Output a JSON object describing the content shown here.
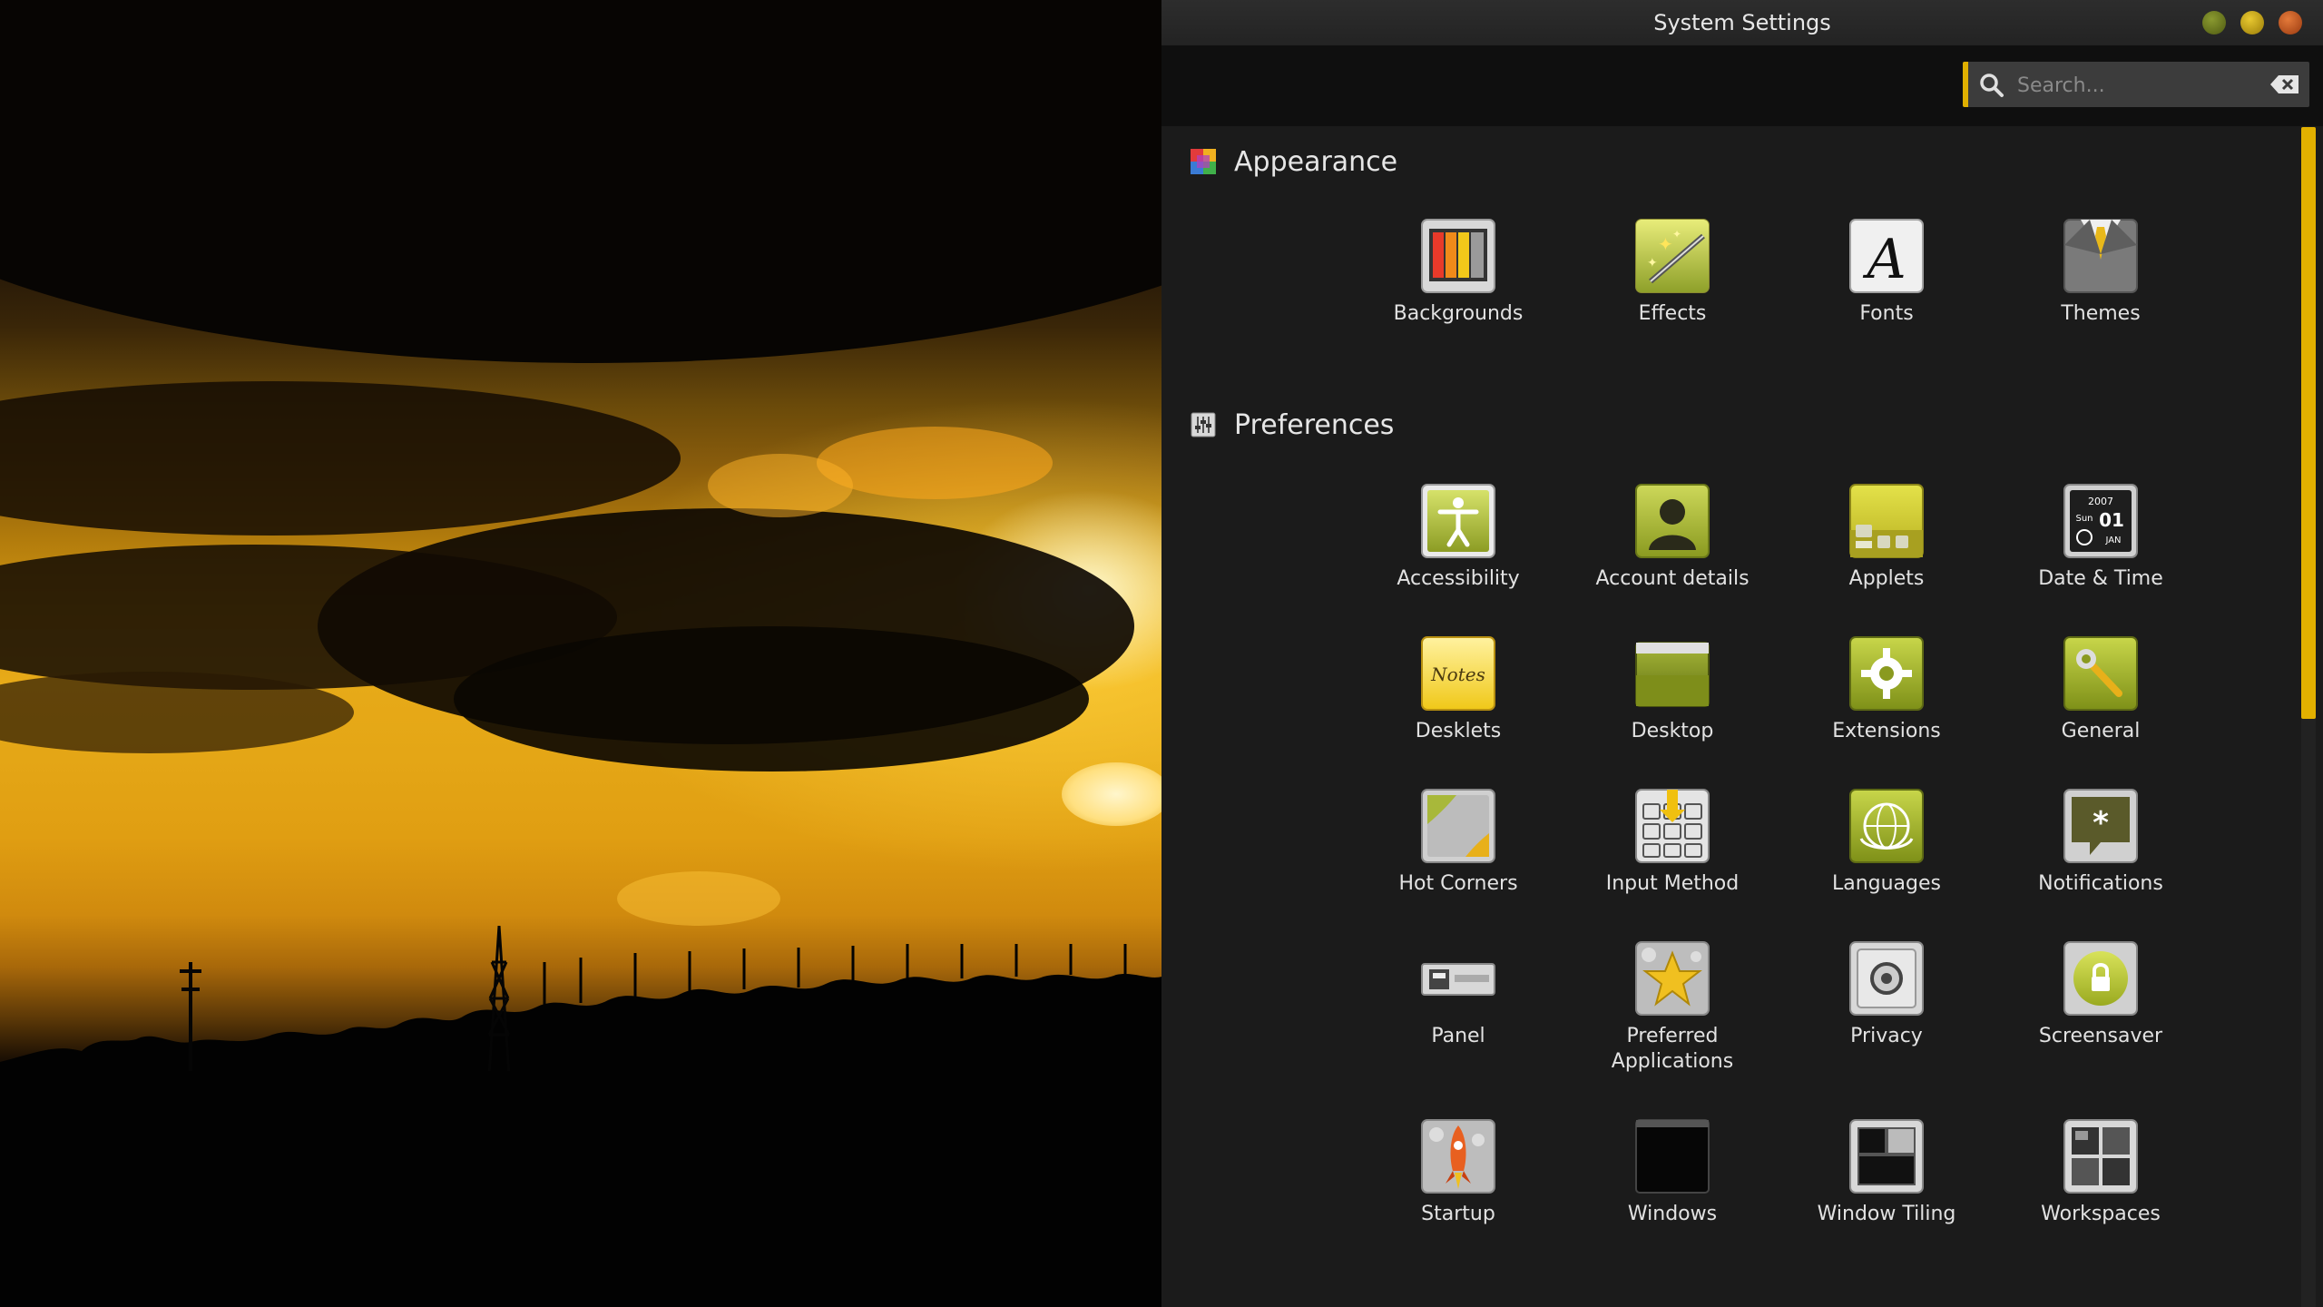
{
  "window": {
    "title": "System Settings",
    "controls": [
      "minimize-icon",
      "maximize-icon",
      "close-icon"
    ]
  },
  "search": {
    "placeholder": "Search...",
    "value": ""
  },
  "colors": {
    "accent": "#e2b000",
    "window_bg": "#1b1b1b",
    "toolbar_bg": "#0f0f0f",
    "text": "#e2e2e2"
  },
  "sections": [
    {
      "label": "Appearance",
      "icon": "appearance-icon",
      "items": [
        {
          "label": "Backgrounds",
          "icon": "backgrounds-icon"
        },
        {
          "label": "Effects",
          "icon": "effects-icon"
        },
        {
          "label": "Fonts",
          "icon": "fonts-icon"
        },
        {
          "label": "Themes",
          "icon": "themes-icon"
        }
      ]
    },
    {
      "label": "Preferences",
      "icon": "preferences-icon",
      "items": [
        {
          "label": "Accessibility",
          "icon": "accessibility-icon"
        },
        {
          "label": "Account details",
          "icon": "account-details-icon"
        },
        {
          "label": "Applets",
          "icon": "applets-icon"
        },
        {
          "label": "Date & Time",
          "icon": "date-time-icon",
          "icon_text": {
            "year": "2007",
            "day": "Sun",
            "date": "01",
            "month": "JAN"
          }
        },
        {
          "label": "Desklets",
          "icon": "desklets-icon",
          "icon_text": "Notes"
        },
        {
          "label": "Desktop",
          "icon": "desktop-icon"
        },
        {
          "label": "Extensions",
          "icon": "extensions-icon"
        },
        {
          "label": "General",
          "icon": "general-icon"
        },
        {
          "label": "Hot Corners",
          "icon": "hot-corners-icon"
        },
        {
          "label": "Input Method",
          "icon": "input-method-icon"
        },
        {
          "label": "Languages",
          "icon": "languages-icon"
        },
        {
          "label": "Notifications",
          "icon": "notifications-icon"
        },
        {
          "label": "Panel",
          "icon": "panel-icon"
        },
        {
          "label": "Preferred Applications",
          "icon": "preferred-applications-icon"
        },
        {
          "label": "Privacy",
          "icon": "privacy-icon"
        },
        {
          "label": "Screensaver",
          "icon": "screensaver-icon"
        },
        {
          "label": "Startup",
          "icon": "startup-icon"
        },
        {
          "label": "Windows",
          "icon": "windows-icon"
        },
        {
          "label": "Window Tiling",
          "icon": "window-tiling-icon"
        },
        {
          "label": "Workspaces",
          "icon": "workspaces-icon"
        }
      ]
    }
  ]
}
